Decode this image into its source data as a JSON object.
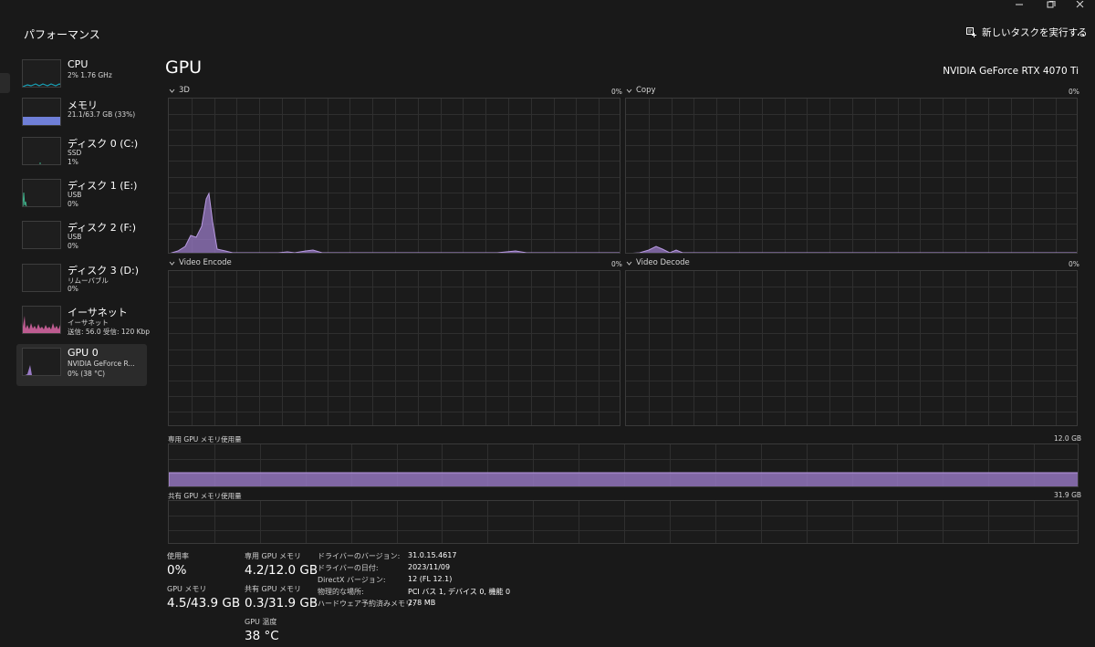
{
  "window": {
    "title": "パフォーマンス",
    "run_task_label": "新しいタスクを実行する",
    "more_label": "..."
  },
  "colors": {
    "accent_gpu": "#9a7bc7",
    "cpu": "#17a2b8",
    "memory": "#6f7fd8",
    "disk": "#3fb18a",
    "network": "#d966a5",
    "background": "#191919"
  },
  "sidebar": {
    "items": [
      {
        "name": "CPU",
        "sub1": "2%  1.76 GHz",
        "sub2": "",
        "sub3": ""
      },
      {
        "name": "メモリ",
        "sub1": "21.1/63.7 GB (33%)",
        "sub2": "",
        "sub3": ""
      },
      {
        "name": "ディスク 0 (C:)",
        "sub1": "SSD",
        "sub2": "1%",
        "sub3": ""
      },
      {
        "name": "ディスク 1 (E:)",
        "sub1": "USB",
        "sub2": "0%",
        "sub3": ""
      },
      {
        "name": "ディスク 2 (F:)",
        "sub1": "USB",
        "sub2": "0%",
        "sub3": ""
      },
      {
        "name": "ディスク 3 (D:)",
        "sub1": "リムーバブル",
        "sub2": "0%",
        "sub3": ""
      },
      {
        "name": "イーサネット",
        "sub1": "イーサネット",
        "sub2": "送信: 56.0  受信: 120 Kbps",
        "sub3": ""
      },
      {
        "name": "GPU 0",
        "sub1": "NVIDIA GeForce R...",
        "sub2": "0%  (38 °C)",
        "sub3": ""
      }
    ]
  },
  "main": {
    "title": "GPU",
    "model": "NVIDIA GeForce RTX 4070 Ti",
    "graphs": [
      {
        "label": "3D",
        "percent": "0%"
      },
      {
        "label": "Copy",
        "percent": "0%"
      },
      {
        "label": "Video Encode",
        "percent": "0%"
      },
      {
        "label": "Video Decode",
        "percent": "0%"
      }
    ],
    "dedicated_memory": {
      "label": "専用 GPU メモリ使用量",
      "max": "12.0 GB",
      "used_fraction": 0.35
    },
    "shared_memory": {
      "label": "共有 GPU メモリ使用量",
      "max": "31.9 GB",
      "used_fraction": 0.01
    }
  },
  "stats": {
    "utilization_label": "使用率",
    "utilization_value": "0%",
    "gpu_memory_label": "GPU メモリ",
    "gpu_memory_value": "4.5/43.9 GB",
    "dedicated_label": "専用 GPU メモリ",
    "dedicated_value": "4.2/12.0 GB",
    "shared_label": "共有 GPU メモリ",
    "shared_value": "0.3/31.9 GB",
    "temp_label": "GPU 温度",
    "temp_value": "38 °C"
  },
  "info": [
    {
      "key": "ドライバーのバージョン:",
      "value": "31.0.15.4617"
    },
    {
      "key": "ドライバーの日付:",
      "value": "2023/11/09"
    },
    {
      "key": "DirectX バージョン:",
      "value": "12 (FL 12.1)"
    },
    {
      "key": "物理的な場所:",
      "value": "PCI バス 1, デバイス 0, 機能 0"
    },
    {
      "key": "ハードウェア予約済みメモリ:",
      "value": "278 MB"
    }
  ]
}
